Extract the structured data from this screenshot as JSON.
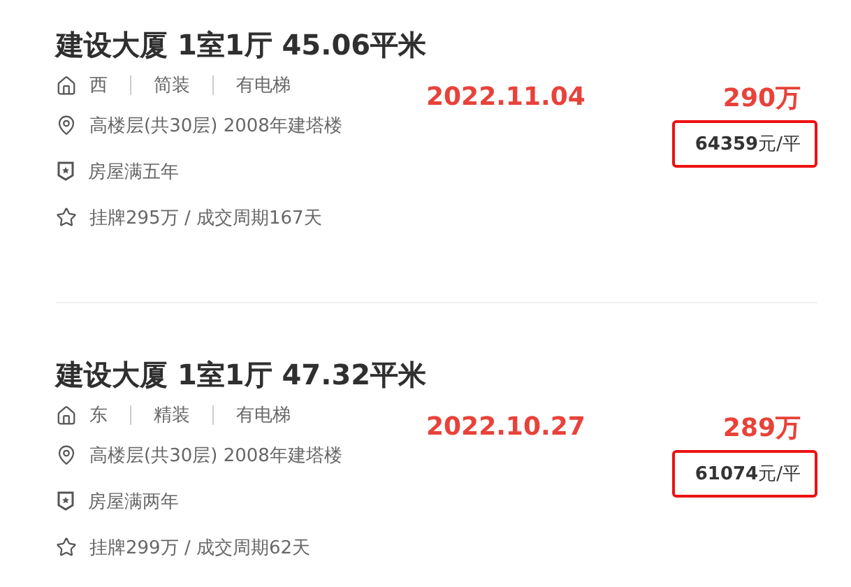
{
  "listings": [
    {
      "title": "建设大厦 1室1厅 45.06平米",
      "tags": [
        "西",
        "简装",
        "有电梯"
      ],
      "location": "高楼层(共30层) 2008年建塔楼",
      "ownership": "房屋满五年",
      "deal": "挂牌295万 / 成交周期167天",
      "date": "2022.11.04",
      "price": "290万",
      "unit_price": "**64359**元/平"
    },
    {
      "title": "建设大厦 1室1厅 47.32平米",
      "tags": [
        "东",
        "精装",
        "有电梯"
      ],
      "location": "高楼层(共30层) 2008年建塔楼",
      "ownership": "房屋满两年",
      "deal": "挂牌299万 / 成交周期62天",
      "date": "2022.10.27",
      "price": "289万",
      "unit_price": "**61074**元/平"
    }
  ]
}
